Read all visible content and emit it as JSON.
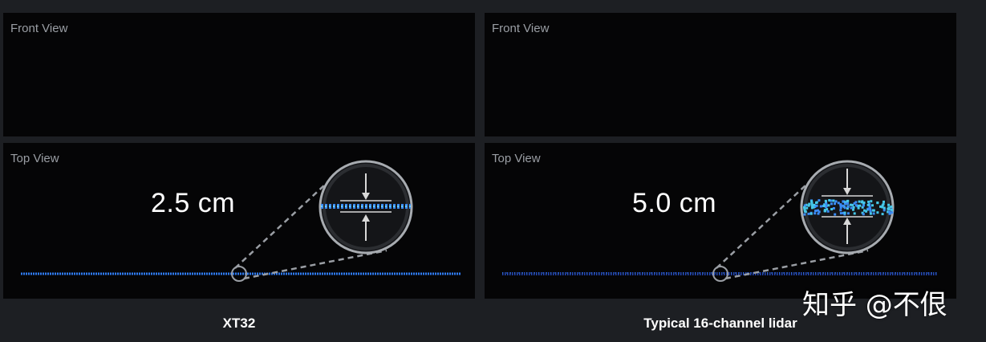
{
  "left": {
    "front_label": "Front View",
    "top_label": "Top View",
    "measurement": "2.5 cm",
    "caption": "XT32"
  },
  "right": {
    "front_label": "Front View",
    "top_label": "Top View",
    "measurement": "5.0 cm",
    "caption": "Typical 16-channel lidar"
  },
  "watermark": "知乎 @不佷",
  "colors": {
    "background": "#1d1f23",
    "panel": "#050506",
    "line_blue": "#2f7bf2",
    "line_cyan": "#3fe6d8",
    "zoom_ring": "#9a9ea4",
    "label": "#9a9ea4"
  }
}
